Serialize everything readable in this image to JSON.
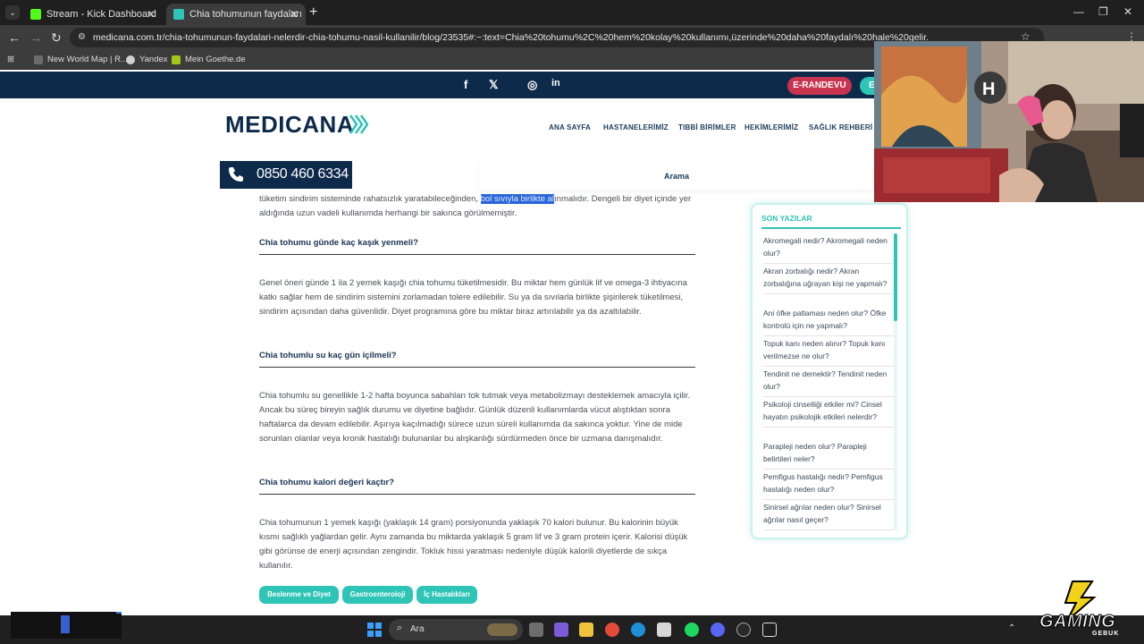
{
  "browser": {
    "tabs": [
      {
        "label": "Stream - Kick Dashboard",
        "favicon_color": "#53fc18"
      },
      {
        "label": "Chia tohumunun faydaları nelerdir",
        "favicon_color": "#2ec4b6"
      }
    ],
    "new_tab": "+",
    "url": "medicana.com.tr/chia-tohumunun-faydalari-nelerdir-chia-tohumu-nasil-kullanilir/blog/23535#:~:text=Chia%20tohumu%2C%20hem%20kolay%20kullanımı,üzerinde%20daha%20faydalı%20hale%20gelir.",
    "bookmarks": [
      "New World Map | R...",
      "Yandex",
      "Mein Goethe.de"
    ]
  },
  "site": {
    "social_icons": [
      "facebook-icon",
      "x-icon",
      "instagram-icon",
      "linkedin-icon"
    ],
    "social_glyphs": [
      "f",
      "𝕏",
      "◎",
      "in"
    ],
    "erandevu": "E-RANDEVU",
    "erandevu2": "E",
    "logo": "MEDICANA",
    "menu": [
      "ANA SAYFA",
      "HASTANELERİMİZ",
      "TIBBİ BİRİMLER",
      "HEKİMLERİMİZ",
      "SAĞLIK REHBERİ"
    ],
    "phone": "0850 460 6334",
    "search_label": "Arama"
  },
  "article": {
    "intro_pre": "tüketim sindirim sisteminde rahatsızlık yaratabileceğinden, ",
    "intro_highlight": "bol sıvıyla birlikte al",
    "intro_post": "ınmalıdır. Dengeli bir diyet içinde yer aldığında uzun vadeli kullanımda herhangi bir sakınca görülmemiştir.",
    "sections": [
      {
        "heading": "Chia tohumu günde kaç kaşık yenmeli?",
        "body": "Genel öneri günde 1 ila 2 yemek kaşığı chia tohumu tüketilmesidir. Bu miktar hem günlük lif ve omega-3 ihtiyacına katkı sağlar hem de sindirim sistemini zorlamadan tolere edilebilir. Su ya da sıvılarla birlikte şişirilerek tüketilmesi, sindirim açısından daha güvenlidir. Diyet programına göre bu miktar biraz artırılabilir ya da azaltılabilir."
      },
      {
        "heading": "Chia tohumlu su kaç gün içilmeli?",
        "body": "Chia tohumlu su genellikle 1-2 hafta boyunca sabahları tok tutmak veya metabolizmayı desteklemek amacıyla içilir. Ancak bu süreç bireyin sağlık durumu ve diyetine bağlıdır. Günlük düzenli kullanımlarda vücut alıştıktan sonra haftalarca da devam edilebilir. Aşırıya kaçılmadığı sürece uzun süreli kullanımda da sakınca yoktur. Yine de mide sorunları olanlar veya kronik hastalığı bulunanlar bu alışkanlığı sürdürmeden önce bir uzmana danışmalıdır."
      },
      {
        "heading": "Chia tohumu kalori değeri kaçtır?",
        "body": "Chia tohumunun 1 yemek kaşığı (yaklaşık 14 gram) porsiyonunda yaklaşık 70 kalori bulunur. Bu kalorinin büyük kısmı sağlıklı yağlardan gelir. Aynı zamanda bu miktarda yaklaşık 5 gram lif ve 3 gram protein içerir. Kalorisi düşük gibi görünse de enerji açısından zengindir. Tokluk hissi yaratması nedeniyle düşük kalorili diyetlerde de sıkça kullanılır."
      }
    ],
    "tags": [
      "Beslenme ve Diyet",
      "Gastroenteroloji",
      "İç Hastalıkları"
    ]
  },
  "sidebar": {
    "title": "SON YAZILAR",
    "items": [
      "Akromegali nedir? Akromegali neden olur?",
      "Akran zorbalığı nedir? Akran zorbalığına uğrayan kişi ne yapmalı?",
      "Ani öfke patlaması neden olur? Öfke kontrolü için ne yapmalı?",
      "Topuk kanı neden alınır? Topuk kanı verilmezse ne olur?",
      "Tendinit ne demektir? Tendinit neden olur?",
      "Psikoloji cinselliği etkiler mi? Cinsel hayatın psikolojik etkileri nelerdir?",
      "Parapleji neden olur? Parapleji belirtileri neler?",
      "Pemfigus hastalığı nedir? Pemfigus hastalığı neden olur?",
      "Sinirsel ağrılar neden olur? Sinirsel ağrılar nasıl geçer?"
    ]
  },
  "taskbar": {
    "search_label": "Ara",
    "overlay_brand": "GAMING",
    "overlay_brand_sub": "GEBUK"
  },
  "colors": {
    "navy": "#0d2a4a",
    "teal": "#2ec4b6",
    "red": "#c8344f"
  }
}
